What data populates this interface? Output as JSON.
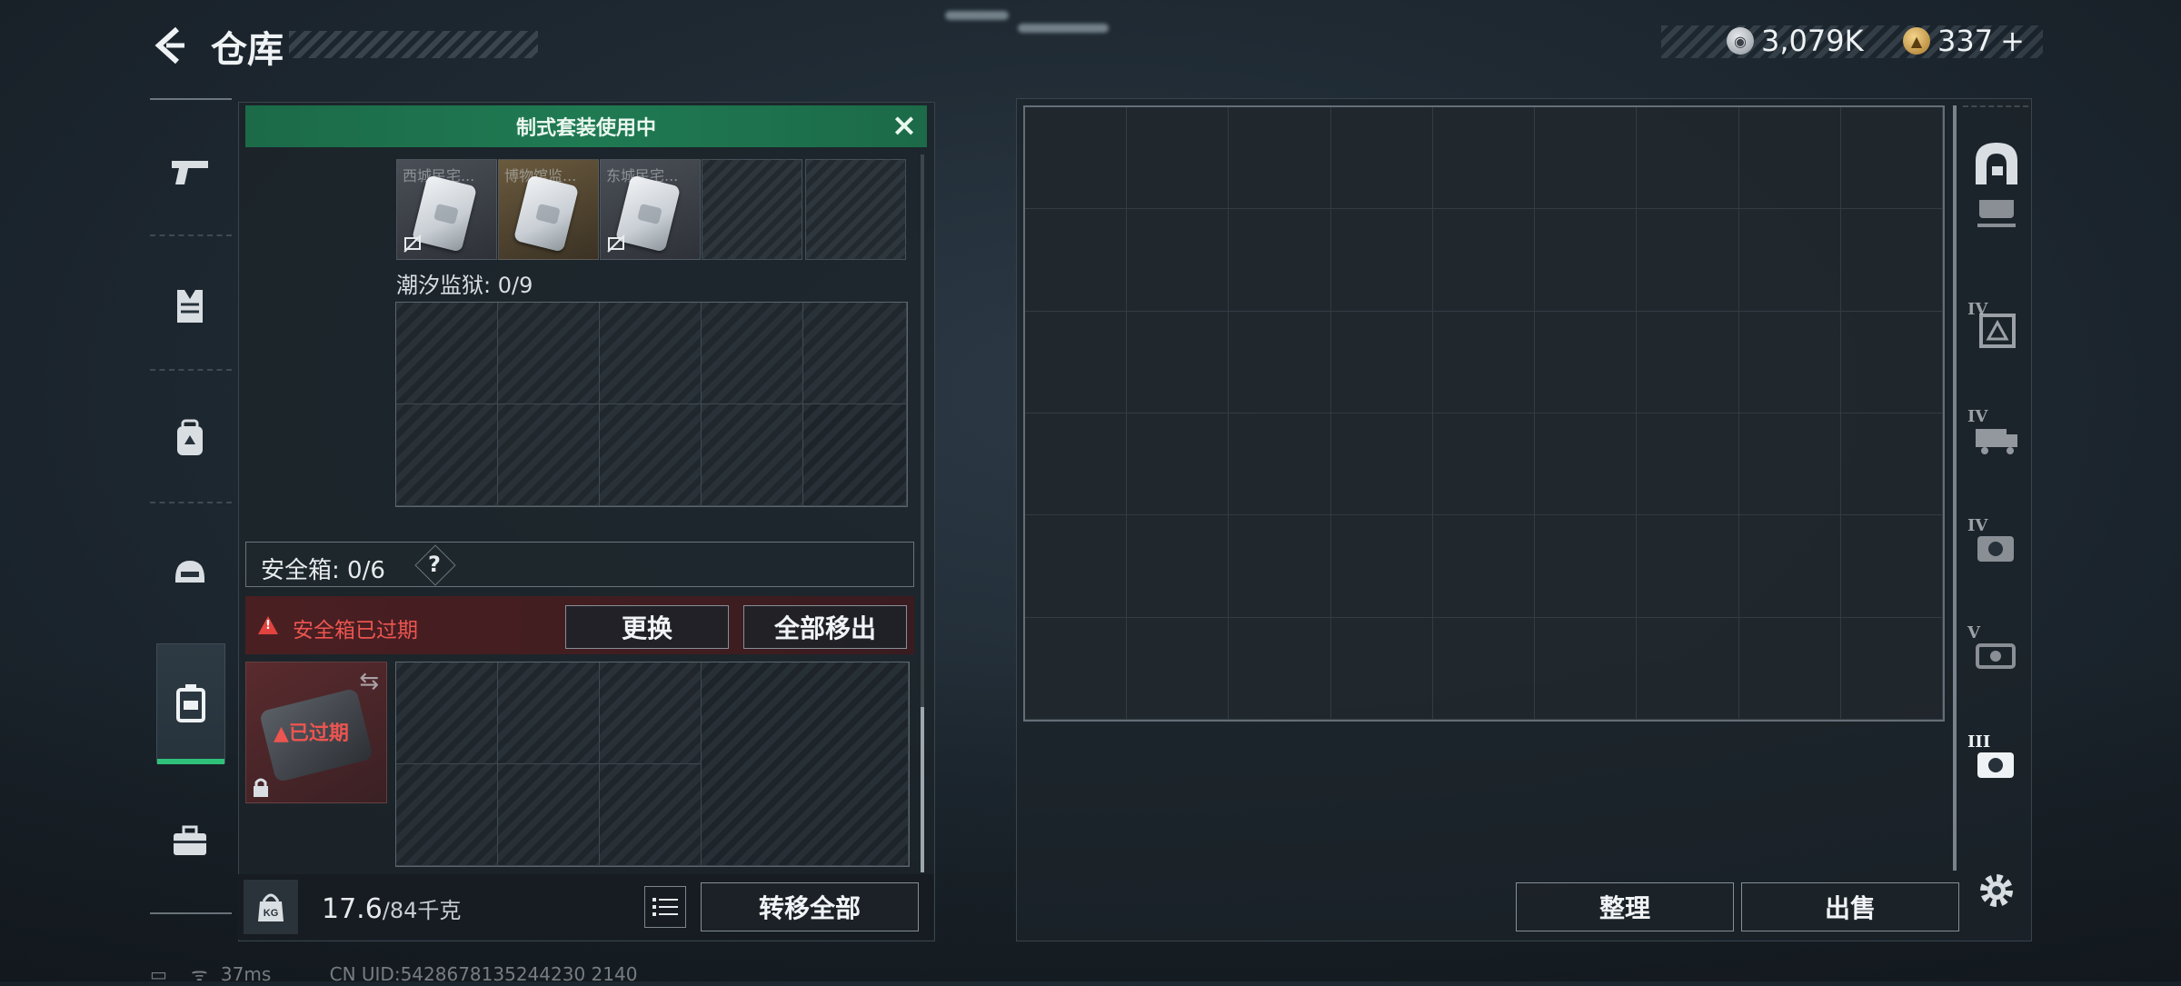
{
  "header": {
    "title": "仓库",
    "currency_silver": "3,079K",
    "currency_gold": "337",
    "currency_gold_add": "+"
  },
  "left_nav": {
    "items": [
      {
        "name": "weapons",
        "icon": "pistol-icon"
      },
      {
        "name": "armor",
        "icon": "vest-icon"
      },
      {
        "name": "backpack",
        "icon": "backpack-icon"
      },
      {
        "name": "helmet",
        "icon": "helmet-icon"
      },
      {
        "name": "safe-box",
        "icon": "case-icon",
        "active": true
      },
      {
        "name": "toolbox",
        "icon": "toolbox-icon"
      }
    ]
  },
  "kit_banner": {
    "text": "制式套装使用中"
  },
  "key_slots": [
    {
      "label": "西城民宅...",
      "style": "silver",
      "disabled": true
    },
    {
      "label": "博物馆监...",
      "style": "gold",
      "disabled": false
    },
    {
      "label": "东城民宅...",
      "style": "silver",
      "disabled": true
    }
  ],
  "prison_section": {
    "label": "潮汐监狱: 0/9"
  },
  "safe_box": {
    "label": "安全箱:  0/6",
    "help": "?",
    "expired_warning": "安全箱已过期",
    "replace_button": "更换",
    "remove_all_button": "全部移出",
    "item_status": "已过期"
  },
  "footer_left": {
    "weight_icon": "KG",
    "weight_current": "17.6",
    "weight_max": "/84千克",
    "transfer_all_button": "转移全部"
  },
  "right_panel": {
    "tabs": [
      {
        "level": "",
        "icon": "arch-icon"
      },
      {
        "level": "",
        "icon": "gun-case-icon"
      },
      {
        "level": "IV",
        "icon": "crate-icon"
      },
      {
        "level": "IV",
        "icon": "truck-icon"
      },
      {
        "level": "IV",
        "icon": "camera-icon"
      },
      {
        "level": "V",
        "icon": "projector-icon"
      },
      {
        "level": "III",
        "icon": "camera-icon-active"
      }
    ],
    "sort_button": "整理",
    "sell_button": "出售"
  },
  "status_bar": {
    "ping": "37ms",
    "uid": "CN UID:5428678135244230 2140"
  },
  "colors": {
    "accent_green": "#2fc07a",
    "banner_green": "#1f7a52",
    "warning_red": "#ec5550"
  }
}
